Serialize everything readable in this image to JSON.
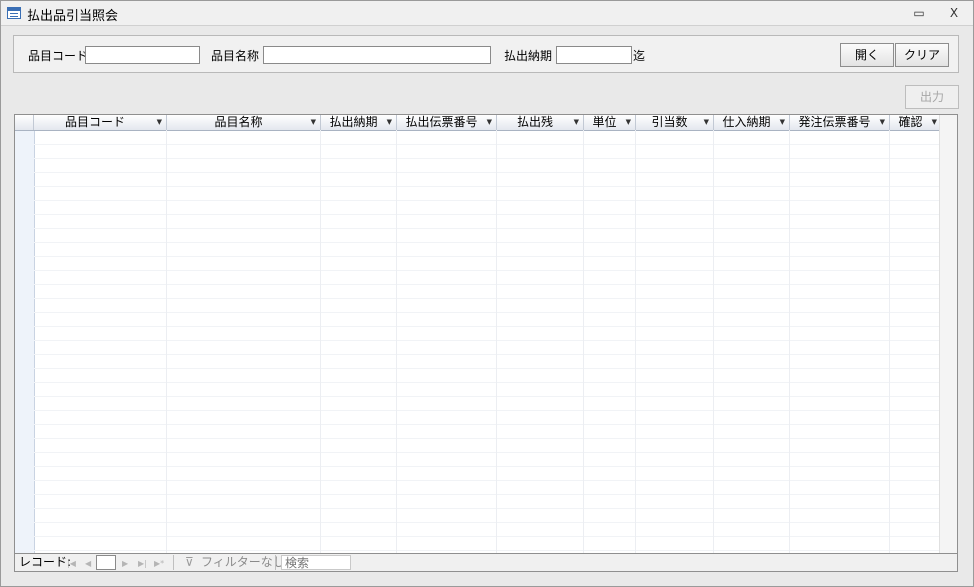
{
  "window": {
    "title": "払出品引当照会",
    "minimize_glyph": "▭",
    "close_glyph": "X"
  },
  "filters": {
    "item_code_label": "品目コード",
    "item_code_value": "",
    "item_name_label": "品目名称",
    "item_name_value": "",
    "due_date_label": "払出納期",
    "due_date_value": "",
    "due_date_suffix": "迄"
  },
  "buttons": {
    "open": "開く",
    "clear": "クリア",
    "output": "出力"
  },
  "grid": {
    "columns": [
      {
        "label": "品目コード"
      },
      {
        "label": "品目名称"
      },
      {
        "label": "払出納期"
      },
      {
        "label": "払出伝票番号"
      },
      {
        "label": "払出残"
      },
      {
        "label": "単位"
      },
      {
        "label": "引当数"
      },
      {
        "label": "仕入納期"
      },
      {
        "label": "発注伝票番号"
      },
      {
        "label": "確認"
      }
    ],
    "rows": []
  },
  "navbar": {
    "record_label": "レコード:",
    "first_icon": "first-record-icon",
    "prev_icon": "previous-record-icon",
    "record_value": "",
    "next_icon": "next-record-icon",
    "last_icon": "last-record-icon",
    "new_icon": "new-record-icon",
    "filter_label": "フィルターなし",
    "search_label": "検索"
  }
}
